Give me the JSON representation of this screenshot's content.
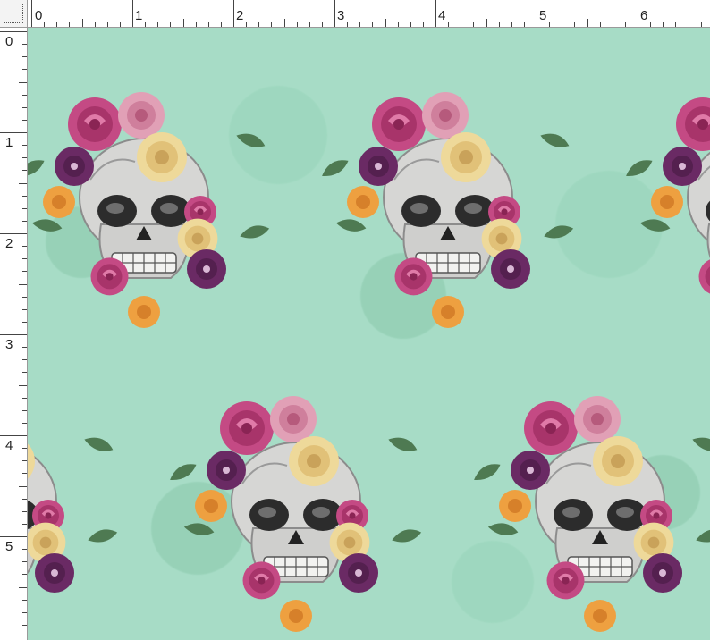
{
  "ruler_top": {
    "labels": [
      "0",
      "1",
      "2",
      "3",
      "4",
      "5",
      "6"
    ]
  },
  "ruler_left": {
    "labels": [
      "0",
      "1",
      "2",
      "3",
      "4",
      "5"
    ]
  },
  "colors": {
    "background": "#a7dcc6",
    "ruler": "#ffffff",
    "skull": "#d6d6d4",
    "rose": "#c44a84",
    "peony": "#e1a0b6",
    "cream_rose": "#eed99a",
    "purple": "#6a2a64",
    "magenta": "#a3205e",
    "orange": "#eea040",
    "leaf": "#4e7a52"
  },
  "pattern": {
    "name": "floral-skull-print"
  }
}
